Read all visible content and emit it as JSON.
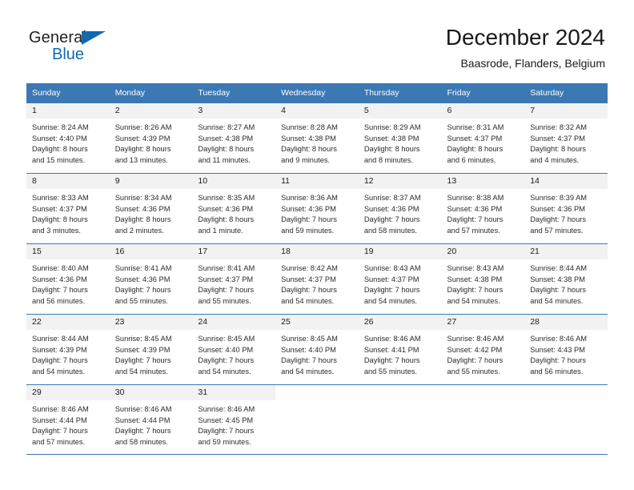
{
  "logo": {
    "word_dark": "General",
    "word_blue": "Blue",
    "triangle_color": "#1269b0"
  },
  "header": {
    "title": "December 2024",
    "subtitle": "Baasrode, Flanders, Belgium",
    "accent_color": "#3b78b4",
    "header_text_color": "#ffffff",
    "daynum_band_color": "#f2f2f2"
  },
  "weekday_headers": [
    "Sunday",
    "Monday",
    "Tuesday",
    "Wednesday",
    "Thursday",
    "Friday",
    "Saturday"
  ],
  "weeks": [
    {
      "days": [
        {
          "num": "1",
          "sunrise": "Sunrise: 8:24 AM",
          "sunset": "Sunset: 4:40 PM",
          "daylight1": "Daylight: 8 hours",
          "daylight2": "and 15 minutes."
        },
        {
          "num": "2",
          "sunrise": "Sunrise: 8:26 AM",
          "sunset": "Sunset: 4:39 PM",
          "daylight1": "Daylight: 8 hours",
          "daylight2": "and 13 minutes."
        },
        {
          "num": "3",
          "sunrise": "Sunrise: 8:27 AM",
          "sunset": "Sunset: 4:38 PM",
          "daylight1": "Daylight: 8 hours",
          "daylight2": "and 11 minutes."
        },
        {
          "num": "4",
          "sunrise": "Sunrise: 8:28 AM",
          "sunset": "Sunset: 4:38 PM",
          "daylight1": "Daylight: 8 hours",
          "daylight2": "and 9 minutes."
        },
        {
          "num": "5",
          "sunrise": "Sunrise: 8:29 AM",
          "sunset": "Sunset: 4:38 PM",
          "daylight1": "Daylight: 8 hours",
          "daylight2": "and 8 minutes."
        },
        {
          "num": "6",
          "sunrise": "Sunrise: 8:31 AM",
          "sunset": "Sunset: 4:37 PM",
          "daylight1": "Daylight: 8 hours",
          "daylight2": "and 6 minutes."
        },
        {
          "num": "7",
          "sunrise": "Sunrise: 8:32 AM",
          "sunset": "Sunset: 4:37 PM",
          "daylight1": "Daylight: 8 hours",
          "daylight2": "and 4 minutes."
        }
      ]
    },
    {
      "days": [
        {
          "num": "8",
          "sunrise": "Sunrise: 8:33 AM",
          "sunset": "Sunset: 4:37 PM",
          "daylight1": "Daylight: 8 hours",
          "daylight2": "and 3 minutes."
        },
        {
          "num": "9",
          "sunrise": "Sunrise: 8:34 AM",
          "sunset": "Sunset: 4:36 PM",
          "daylight1": "Daylight: 8 hours",
          "daylight2": "and 2 minutes."
        },
        {
          "num": "10",
          "sunrise": "Sunrise: 8:35 AM",
          "sunset": "Sunset: 4:36 PM",
          "daylight1": "Daylight: 8 hours",
          "daylight2": "and 1 minute."
        },
        {
          "num": "11",
          "sunrise": "Sunrise: 8:36 AM",
          "sunset": "Sunset: 4:36 PM",
          "daylight1": "Daylight: 7 hours",
          "daylight2": "and 59 minutes."
        },
        {
          "num": "12",
          "sunrise": "Sunrise: 8:37 AM",
          "sunset": "Sunset: 4:36 PM",
          "daylight1": "Daylight: 7 hours",
          "daylight2": "and 58 minutes."
        },
        {
          "num": "13",
          "sunrise": "Sunrise: 8:38 AM",
          "sunset": "Sunset: 4:36 PM",
          "daylight1": "Daylight: 7 hours",
          "daylight2": "and 57 minutes."
        },
        {
          "num": "14",
          "sunrise": "Sunrise: 8:39 AM",
          "sunset": "Sunset: 4:36 PM",
          "daylight1": "Daylight: 7 hours",
          "daylight2": "and 57 minutes."
        }
      ]
    },
    {
      "days": [
        {
          "num": "15",
          "sunrise": "Sunrise: 8:40 AM",
          "sunset": "Sunset: 4:36 PM",
          "daylight1": "Daylight: 7 hours",
          "daylight2": "and 56 minutes."
        },
        {
          "num": "16",
          "sunrise": "Sunrise: 8:41 AM",
          "sunset": "Sunset: 4:36 PM",
          "daylight1": "Daylight: 7 hours",
          "daylight2": "and 55 minutes."
        },
        {
          "num": "17",
          "sunrise": "Sunrise: 8:41 AM",
          "sunset": "Sunset: 4:37 PM",
          "daylight1": "Daylight: 7 hours",
          "daylight2": "and 55 minutes."
        },
        {
          "num": "18",
          "sunrise": "Sunrise: 8:42 AM",
          "sunset": "Sunset: 4:37 PM",
          "daylight1": "Daylight: 7 hours",
          "daylight2": "and 54 minutes."
        },
        {
          "num": "19",
          "sunrise": "Sunrise: 8:43 AM",
          "sunset": "Sunset: 4:37 PM",
          "daylight1": "Daylight: 7 hours",
          "daylight2": "and 54 minutes."
        },
        {
          "num": "20",
          "sunrise": "Sunrise: 8:43 AM",
          "sunset": "Sunset: 4:38 PM",
          "daylight1": "Daylight: 7 hours",
          "daylight2": "and 54 minutes."
        },
        {
          "num": "21",
          "sunrise": "Sunrise: 8:44 AM",
          "sunset": "Sunset: 4:38 PM",
          "daylight1": "Daylight: 7 hours",
          "daylight2": "and 54 minutes."
        }
      ]
    },
    {
      "days": [
        {
          "num": "22",
          "sunrise": "Sunrise: 8:44 AM",
          "sunset": "Sunset: 4:39 PM",
          "daylight1": "Daylight: 7 hours",
          "daylight2": "and 54 minutes."
        },
        {
          "num": "23",
          "sunrise": "Sunrise: 8:45 AM",
          "sunset": "Sunset: 4:39 PM",
          "daylight1": "Daylight: 7 hours",
          "daylight2": "and 54 minutes."
        },
        {
          "num": "24",
          "sunrise": "Sunrise: 8:45 AM",
          "sunset": "Sunset: 4:40 PM",
          "daylight1": "Daylight: 7 hours",
          "daylight2": "and 54 minutes."
        },
        {
          "num": "25",
          "sunrise": "Sunrise: 8:45 AM",
          "sunset": "Sunset: 4:40 PM",
          "daylight1": "Daylight: 7 hours",
          "daylight2": "and 54 minutes."
        },
        {
          "num": "26",
          "sunrise": "Sunrise: 8:46 AM",
          "sunset": "Sunset: 4:41 PM",
          "daylight1": "Daylight: 7 hours",
          "daylight2": "and 55 minutes."
        },
        {
          "num": "27",
          "sunrise": "Sunrise: 8:46 AM",
          "sunset": "Sunset: 4:42 PM",
          "daylight1": "Daylight: 7 hours",
          "daylight2": "and 55 minutes."
        },
        {
          "num": "28",
          "sunrise": "Sunrise: 8:46 AM",
          "sunset": "Sunset: 4:43 PM",
          "daylight1": "Daylight: 7 hours",
          "daylight2": "and 56 minutes."
        }
      ]
    },
    {
      "days": [
        {
          "num": "29",
          "sunrise": "Sunrise: 8:46 AM",
          "sunset": "Sunset: 4:44 PM",
          "daylight1": "Daylight: 7 hours",
          "daylight2": "and 57 minutes."
        },
        {
          "num": "30",
          "sunrise": "Sunrise: 8:46 AM",
          "sunset": "Sunset: 4:44 PM",
          "daylight1": "Daylight: 7 hours",
          "daylight2": "and 58 minutes."
        },
        {
          "num": "31",
          "sunrise": "Sunrise: 8:46 AM",
          "sunset": "Sunset: 4:45 PM",
          "daylight1": "Daylight: 7 hours",
          "daylight2": "and 59 minutes."
        },
        {
          "num": "",
          "sunrise": "",
          "sunset": "",
          "daylight1": "",
          "daylight2": ""
        },
        {
          "num": "",
          "sunrise": "",
          "sunset": "",
          "daylight1": "",
          "daylight2": ""
        },
        {
          "num": "",
          "sunrise": "",
          "sunset": "",
          "daylight1": "",
          "daylight2": ""
        },
        {
          "num": "",
          "sunrise": "",
          "sunset": "",
          "daylight1": "",
          "daylight2": ""
        }
      ]
    }
  ]
}
